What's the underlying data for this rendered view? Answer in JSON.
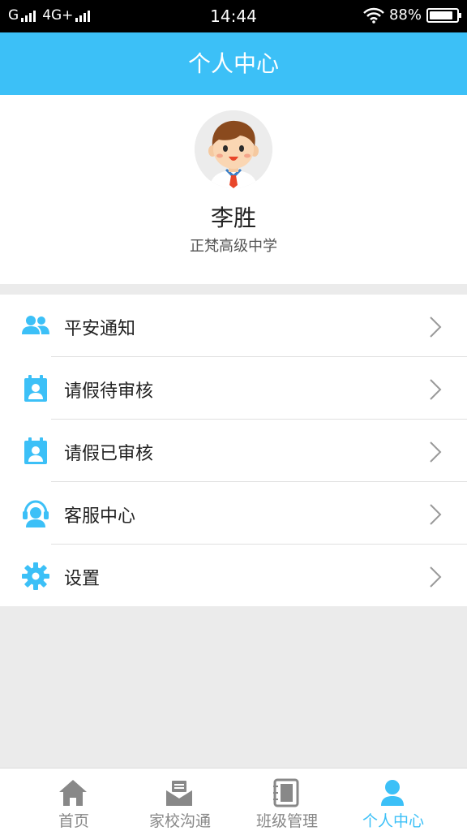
{
  "status_bar": {
    "carrier_left": "G",
    "network": "4G+",
    "time": "14:44",
    "battery": "88%",
    "battery_level": 0.88
  },
  "header": {
    "title": "个人中心"
  },
  "profile": {
    "name": "李胜",
    "school": "正梵高级中学",
    "avatar_icon": "boy-avatar-icon"
  },
  "menu": {
    "items": [
      {
        "label": "平安通知",
        "icon": "people-icon"
      },
      {
        "label": "请假待审核",
        "icon": "calendar-person-icon"
      },
      {
        "label": "请假已审核",
        "icon": "calendar-person-icon"
      },
      {
        "label": "客服中心",
        "icon": "headset-icon"
      },
      {
        "label": "设置",
        "icon": "gear-icon"
      }
    ]
  },
  "bottom_nav": {
    "items": [
      {
        "label": "首页",
        "icon": "home-icon",
        "active": false
      },
      {
        "label": "家校沟通",
        "icon": "mail-icon",
        "active": false
      },
      {
        "label": "班级管理",
        "icon": "notebook-icon",
        "active": false
      },
      {
        "label": "个人中心",
        "icon": "person-icon",
        "active": true
      }
    ]
  },
  "colors": {
    "accent": "#3cc0f7",
    "inactive": "#888888",
    "background": "#ebebeb"
  }
}
